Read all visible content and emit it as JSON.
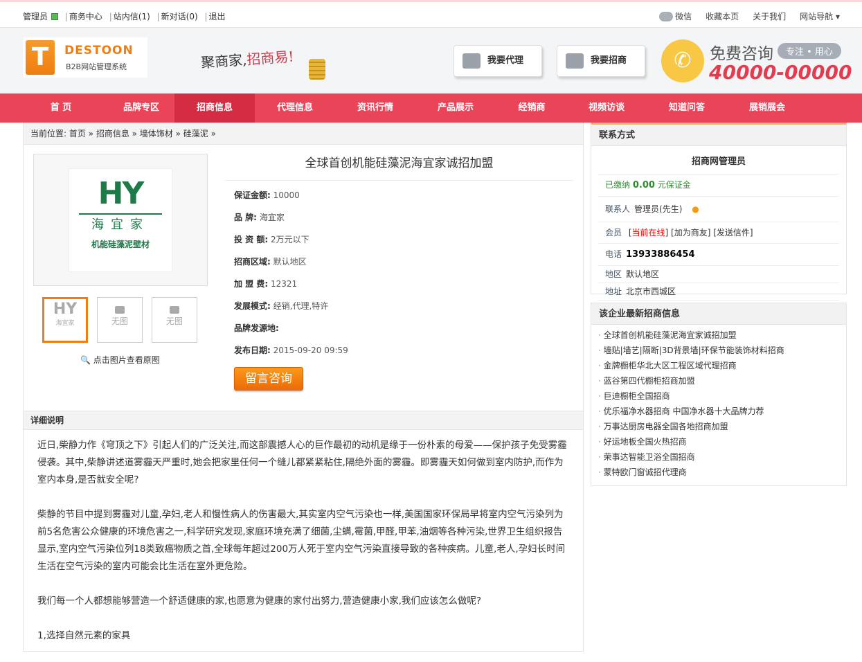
{
  "topbar": {
    "user": "管理员",
    "links": [
      "商务中心",
      "站内信(1)",
      "新对话(0)",
      "退出"
    ],
    "right": [
      "微信",
      "收藏本页",
      "关于我们",
      "网站导航 ▾"
    ]
  },
  "header": {
    "logo_name": "DESTOON",
    "logo_sub": "B2B网站管理系统",
    "slogan_a": "聚商家,",
    "slogan_b": "招商易!",
    "btn_agent": "我要代理",
    "btn_invest": "我要招商",
    "consult": "免费咨询",
    "consult_tag": "专注 • 用心",
    "phone": "40000-00000"
  },
  "nav": [
    "首 页",
    "品牌专区",
    "招商信息",
    "代理信息",
    "资讯行情",
    "产品展示",
    "经销商",
    "视频访谈",
    "知道问答",
    "展销展会"
  ],
  "breadcrumb": "当前位置: 首页 » 招商信息 » 墙体饰材 » 硅藻泥 »",
  "product": {
    "title": "全球首创机能硅藻泥海宜家诚招加盟",
    "logo_text": {
      "mark": "HY",
      "name": "海宜家",
      "desc": "机能硅藻泥壁材"
    },
    "thumbs_empty": "无图",
    "zoom_tip": "点击图片查看原图",
    "info": [
      {
        "k": "保证金额:",
        "v": "10000"
      },
      {
        "k": "品 牌:",
        "v": "海宜家"
      },
      {
        "k": "投 资 额:",
        "v": "2万元以下"
      },
      {
        "k": "招商区域:",
        "v": "默认地区"
      },
      {
        "k": "加 盟 费:",
        "v": "12321"
      },
      {
        "k": "发展模式:",
        "v": "经销,代理,特许"
      },
      {
        "k": "品牌发源地:",
        "v": ""
      },
      {
        "k": "发布日期:",
        "v": "2015-09-20 09:59"
      }
    ],
    "message_btn": "留言咨询"
  },
  "detail": {
    "heading": "详细说明",
    "paragraphs": [
      "近日,柴静力作《穹顶之下》引起人们的广泛关注,而这部震撼人心的巨作最初的动机是缘于一份朴素的母爱——保护孩子免受雾霾侵袭。其中,柴静讲述道雾霾天严重时,她会把家里任何一个缝儿都紧紧粘住,隔绝外面的雾霾。即雾霾天如何做到室内防护,而作为室内本身,是否就安全呢?",
      "柴静的节目中提到雾霾对儿童,孕妇,老人和慢性病人的伤害最大,其实室内空气污染也一样,美国国家环保局早将室内空气污染列为前5名危害公众健康的环境危害之一,科学研究发现,家庭环境充满了细菌,尘螨,霉菌,甲醛,甲苯,油烟等各种污染,世界卫生组织报告显示,室内空气污染位列18类致癌物质之首,全球每年超过200万人死于室内空气污染直接导致的各种疾病。儿童,老人,孕妇长时间生活在空气污染的室内可能会比生活在室外更危险。",
      "我们每一个人都想能够营造一个舒适健康的家,也愿意为健康的家付出努力,营造健康小家,我们应该怎么做呢?",
      "1,选择自然元素的家具"
    ]
  },
  "contact": {
    "heading": "联系方式",
    "company": "招商网管理员",
    "deposit_a": "已缴纳",
    "deposit_amt": "0.00",
    "deposit_b": "元保证金",
    "contact_label": "联系人",
    "contact_name": "管理员(先生)",
    "member_label": "会员",
    "online": "当前在线",
    "add_friend": "[加为商友]",
    "send_mail": "[发送信件]",
    "phone_label": "电话",
    "phone": "13933886454",
    "area_label": "地区",
    "area": "默认地区",
    "addr_label": "地址",
    "addr": "北京市西城区"
  },
  "latest": {
    "heading": "该企业最新招商信息",
    "items": [
      "全球首创机能硅藻泥海宜家诚招加盟",
      "墙贴|墙艺|隔断|3D背景墙|环保节能装饰材料招商",
      "金牌橱柜华北大区工程区域代理招商",
      "蓝谷第四代橱柜招商加盟",
      "巨迪橱柜全国招商",
      "优乐福净水器招商 中国净水器十大品牌力荐",
      "万事达厨房电器全国各地招商加盟",
      "好运地板全国火热招商",
      "荣事达智能卫浴全国招商",
      "蒙特欧门窗诚招代理商"
    ]
  }
}
